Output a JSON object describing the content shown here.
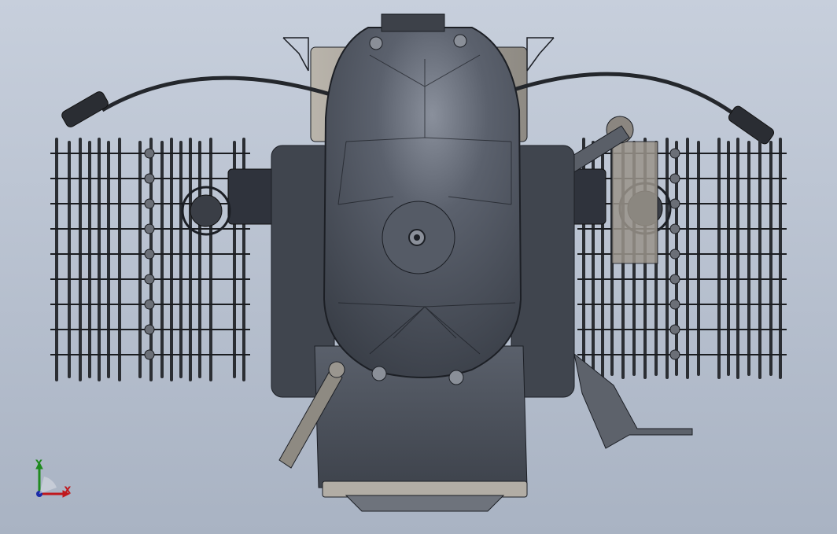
{
  "viewport": {
    "background_top": "#c7cfdc",
    "background_bottom": "#a9b3c3"
  },
  "model": {
    "body_color": "#4a505d",
    "body_dark": "#2f333c",
    "edge_color": "#1c1f25",
    "fin_color": "#2b2e33",
    "metal_light": "#b8b3ab",
    "cable_color": "#24272c"
  },
  "triad": {
    "x_label": "X",
    "y_label": "Y",
    "x_color": "#c0181d",
    "y_color": "#1f8a1f",
    "z_color": "#1b2ba8"
  }
}
